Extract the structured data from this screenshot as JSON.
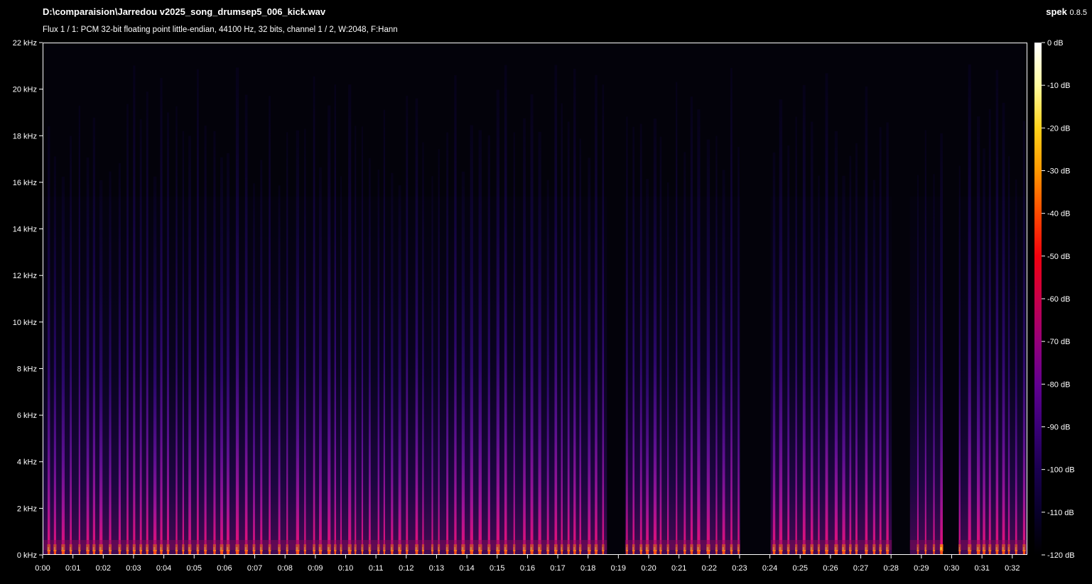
{
  "window": {
    "file_path": "D:\\comparaision\\Jarredou v2025_song_drumsep5_006_kick.wav",
    "app_name": "spek",
    "app_version": "0.8.5",
    "info": "Flux 1 / 1: PCM 32-bit floating point little-endian, 44100 Hz, 32 bits, channel 1 / 2, W:2048, F:Hann"
  },
  "freq_axis": {
    "labels": [
      "0 kHz",
      "2 kHz",
      "4 kHz",
      "6 kHz",
      "8 kHz",
      "10 kHz",
      "12 kHz",
      "14 kHz",
      "16 kHz",
      "18 kHz",
      "20 kHz",
      "22 kHz"
    ],
    "max_khz": 22
  },
  "time_axis": {
    "labels": [
      "0:00",
      "0:01",
      "0:02",
      "0:03",
      "0:04",
      "0:05",
      "0:06",
      "0:07",
      "0:08",
      "0:09",
      "0:10",
      "0:11",
      "0:12",
      "0:13",
      "0:14",
      "0:15",
      "0:16",
      "0:17",
      "0:18",
      "0:19",
      "0:20",
      "0:21",
      "0:22",
      "0:23",
      "0:24",
      "0:25",
      "0:26",
      "0:27",
      "0:28",
      "0:29",
      "0:30",
      "0:31",
      "0:32"
    ]
  },
  "db_scale": {
    "labels": [
      "0 dB",
      "-10 dB",
      "-20 dB",
      "-30 dB",
      "-40 dB",
      "-50 dB",
      "-60 dB",
      "-70 dB",
      "-80 dB",
      "-90 dB",
      "-100 dB",
      "-110 dB",
      "-120 dB"
    ],
    "gradient_colors": [
      "#ffffff",
      "#fffb9f",
      "#ffd21a",
      "#ff9800",
      "#ff4a00",
      "#f2000e",
      "#c8004a",
      "#96007a",
      "#620090",
      "#3a0078",
      "#1a0050",
      "#08002a",
      "#000000"
    ]
  },
  "spectrogram": {
    "gaps_seconds": [
      [
        18.6,
        19.2
      ],
      [
        23.0,
        24.0
      ],
      [
        28.0,
        28.6
      ],
      [
        29.6,
        30.2
      ]
    ]
  }
}
